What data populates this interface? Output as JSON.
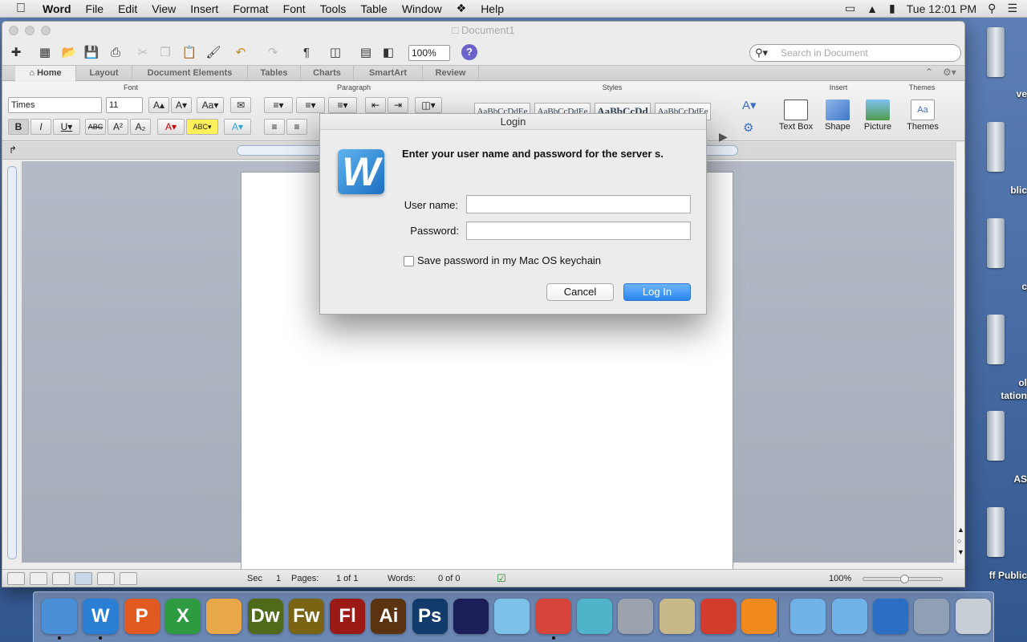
{
  "menubar": {
    "app": "Word",
    "items": [
      "File",
      "Edit",
      "View",
      "Insert",
      "Format",
      "Font",
      "Tools",
      "Table",
      "Window",
      "Help"
    ],
    "clock": "Tue 12:01 PM"
  },
  "desktop": {
    "labels": [
      "ve",
      "blic",
      "c",
      "ol",
      "tation",
      "AS",
      "ff Public"
    ]
  },
  "window": {
    "title": "Document1",
    "zoom": "100%",
    "search_placeholder": "Search in Document",
    "ribbon_tabs": [
      "Home",
      "Layout",
      "Document Elements",
      "Tables",
      "Charts",
      "SmartArt",
      "Review"
    ],
    "groups": {
      "font": "Font",
      "paragraph": "Paragraph",
      "styles": "Styles",
      "insert": "Insert",
      "themes": "Themes"
    },
    "font_name": "Times",
    "font_size": "11",
    "style_samples": [
      "AaBbCcDdEe",
      "AaBbCcDdEe",
      "AaBbCcDd",
      "AaBbCcDdEe"
    ],
    "insert_buttons": [
      "Text Box",
      "Shape",
      "Picture"
    ],
    "themes_label": "Themes",
    "status": {
      "sec_label": "Sec",
      "sec_value": "1",
      "pages_label": "Pages:",
      "pages_value": "1 of 1",
      "words_label": "Words:",
      "words_value": "0 of 0",
      "zoom": "100%"
    }
  },
  "dialog": {
    "title": "Login",
    "message": "Enter your user name and password for the server s.",
    "username_label": "User name:",
    "username_value": "",
    "password_label": "Password:",
    "password_value": "",
    "keychain_label": "Save password in my Mac OS keychain",
    "keychain_checked": false,
    "cancel": "Cancel",
    "login": "Log In"
  },
  "dock": {
    "apps": [
      {
        "name": "finder-icon",
        "label": "",
        "color": "#4a90d9"
      },
      {
        "name": "word-icon",
        "label": "W",
        "color": "#2a7fd4"
      },
      {
        "name": "powerpoint-icon",
        "label": "P",
        "color": "#e05a22"
      },
      {
        "name": "excel-icon",
        "label": "X",
        "color": "#2e9b43"
      },
      {
        "name": "keynote-icon",
        "label": "",
        "color": "#e8a84a"
      },
      {
        "name": "dreamweaver-icon",
        "label": "Dw",
        "color": "#4f6b1a"
      },
      {
        "name": "fireworks-icon",
        "label": "Fw",
        "color": "#7a6312"
      },
      {
        "name": "flash-icon",
        "label": "Fl",
        "color": "#9c1a16"
      },
      {
        "name": "illustrator-icon",
        "label": "Ai",
        "color": "#5a3410"
      },
      {
        "name": "photoshop-icon",
        "label": "Ps",
        "color": "#123a6a"
      },
      {
        "name": "audacity-icon",
        "label": "",
        "color": "#1a1f5a"
      },
      {
        "name": "comic-life-icon",
        "label": "",
        "color": "#7bc1e8"
      },
      {
        "name": "chrome-icon",
        "label": "",
        "color": "#d9443a"
      },
      {
        "name": "sequel-pro-icon",
        "label": "",
        "color": "#4fb4c9"
      },
      {
        "name": "keychain-access-icon",
        "label": "",
        "color": "#9aa2ac"
      },
      {
        "name": "script-editor-icon",
        "label": "",
        "color": "#c9b98a"
      },
      {
        "name": "sketchup-icon",
        "label": "",
        "color": "#d23c2c"
      },
      {
        "name": "vlc-icon",
        "label": "",
        "color": "#f08a1c"
      },
      {
        "name": "downloads-folder-icon",
        "label": "",
        "color": "#6fb3e8"
      },
      {
        "name": "applications-folder-icon",
        "label": "",
        "color": "#6fb3e8"
      },
      {
        "name": "network-icon",
        "label": "",
        "color": "#2a6fc4"
      },
      {
        "name": "shared-users-icon",
        "label": "",
        "color": "#8fa0b5"
      },
      {
        "name": "trash-icon",
        "label": "",
        "color": "#c8ced6"
      }
    ]
  }
}
